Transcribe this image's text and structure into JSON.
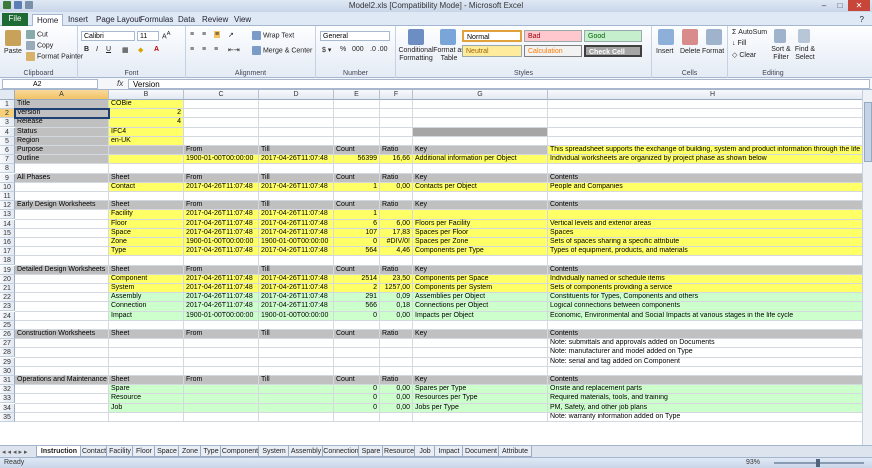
{
  "window": {
    "title": "Model2.xls  [Compatibility Mode]  -  Microsoft Excel"
  },
  "ribbon_tabs": [
    "File",
    "Home",
    "Insert",
    "Page Layout",
    "Formulas",
    "Data",
    "Review",
    "View"
  ],
  "ribbon": {
    "clipboard": {
      "paste": "Paste",
      "cut": "Cut",
      "copy": "Copy",
      "format_painter": "Format Painter",
      "label": "Clipboard"
    },
    "font": {
      "name": "Calibri",
      "size": "11",
      "label": "Font"
    },
    "alignment": {
      "wrap": "Wrap Text",
      "merge": "Merge & Center",
      "label": "Alignment"
    },
    "number": {
      "format": "General",
      "label": "Number"
    },
    "styles": {
      "conditional": "Conditional Formatting",
      "format_table": "Format as Table",
      "normal": "Normal",
      "bad": "Bad",
      "good": "Good",
      "neutral": "Neutral",
      "calculation": "Calculation",
      "check_cell": "Check Cell",
      "label": "Styles"
    },
    "cells": {
      "insert": "Insert",
      "delete": "Delete",
      "format": "Format",
      "label": "Cells"
    },
    "editing": {
      "autosum": "AutoSum",
      "fill": "Fill",
      "clear": "Clear",
      "sort": "Sort & Filter",
      "find": "Find & Select",
      "label": "Editing"
    }
  },
  "formula_bar": {
    "name_box": "A2",
    "fx": "fx",
    "content": "Version"
  },
  "columns": [
    "A",
    "B",
    "C",
    "D",
    "E",
    "F",
    "G",
    "H"
  ],
  "rows": [
    {
      "n": "1",
      "c": [
        {
          "v": "Title",
          "f": "g"
        },
        {
          "v": "COBie",
          "f": "y"
        },
        {},
        {},
        {},
        {},
        {},
        {}
      ]
    },
    {
      "n": "2",
      "c": [
        {
          "v": "Version",
          "f": "g",
          "s": 1
        },
        {
          "v": "2",
          "f": "y",
          "num": 1
        },
        {},
        {},
        {},
        {},
        {},
        {}
      ]
    },
    {
      "n": "3",
      "c": [
        {
          "v": "Release",
          "f": "g"
        },
        {
          "v": "4",
          "f": "y",
          "num": 1
        },
        {},
        {},
        {},
        {},
        {},
        {}
      ]
    },
    {
      "n": "4",
      "c": [
        {
          "v": "Status",
          "f": "g"
        },
        {
          "v": "IFC4",
          "f": "y"
        },
        {},
        {},
        {},
        {},
        {
          "v": "",
          "f": "dg"
        },
        {}
      ]
    },
    {
      "n": "5",
      "c": [
        {
          "v": "Region",
          "f": "g"
        },
        {
          "v": "en-UK",
          "f": "y"
        },
        {},
        {},
        {},
        {},
        {},
        {}
      ]
    },
    {
      "n": "6",
      "c": [
        {
          "v": "Purpose",
          "f": "g"
        },
        {
          "v": "",
          "f": "g"
        },
        {
          "v": "From",
          "f": "g"
        },
        {
          "v": "Till",
          "f": "g"
        },
        {
          "v": "Count",
          "f": "g"
        },
        {
          "v": "Ratio",
          "f": "g"
        },
        {
          "v": "Key",
          "f": "g"
        },
        {
          "v": "This spreadsheet supports the exchange of building, system and product information through the life c",
          "f": "y"
        }
      ]
    },
    {
      "n": "7",
      "c": [
        {
          "v": "Outline",
          "f": "g"
        },
        {
          "v": "",
          "f": "y"
        },
        {
          "v": "1900-01-00T00:00:00",
          "f": "y"
        },
        {
          "v": "2017-04-26T11:07:48",
          "f": "y"
        },
        {
          "v": "56399",
          "f": "y",
          "num": 1
        },
        {
          "v": "16,66",
          "f": "y",
          "num": 1
        },
        {
          "v": "Additional information per Object",
          "f": "y"
        },
        {
          "v": "Individual worksheets are organized by project phase as shown below",
          "f": "y"
        }
      ]
    },
    {
      "n": "8",
      "c": [
        {},
        {},
        {},
        {},
        {},
        {},
        {},
        {}
      ]
    },
    {
      "n": "9",
      "c": [
        {
          "v": "All Phases",
          "f": "g"
        },
        {
          "v": "Sheet",
          "f": "g"
        },
        {
          "v": "From",
          "f": "g"
        },
        {
          "v": "Till",
          "f": "g"
        },
        {
          "v": "Count",
          "f": "g"
        },
        {
          "v": "Ratio",
          "f": "g"
        },
        {
          "v": "Key",
          "f": "g"
        },
        {
          "v": "Contents",
          "f": "g"
        }
      ]
    },
    {
      "n": "10",
      "c": [
        {},
        {
          "v": "Contact",
          "f": "y"
        },
        {
          "v": "2017-04-26T11:07:48",
          "f": "y"
        },
        {
          "v": "2017-04-26T11:07:48",
          "f": "y"
        },
        {
          "v": "1",
          "f": "y",
          "num": 1
        },
        {
          "v": "0,00",
          "f": "y",
          "num": 1
        },
        {
          "v": "Contacts per Object",
          "f": "y"
        },
        {
          "v": "People and Companies",
          "f": "y"
        }
      ]
    },
    {
      "n": "11",
      "c": [
        {},
        {},
        {},
        {},
        {},
        {},
        {},
        {}
      ]
    },
    {
      "n": "12",
      "c": [
        {
          "v": "Early Design Worksheets",
          "f": "g"
        },
        {
          "v": "Sheet",
          "f": "g"
        },
        {
          "v": "From",
          "f": "g"
        },
        {
          "v": "Till",
          "f": "g"
        },
        {
          "v": "Count",
          "f": "g"
        },
        {
          "v": "Ratio",
          "f": "g"
        },
        {
          "v": "Key",
          "f": "g"
        },
        {
          "v": "Contents",
          "f": "g"
        }
      ]
    },
    {
      "n": "13",
      "c": [
        {},
        {
          "v": "Facility",
          "f": "y"
        },
        {
          "v": "2017-04-26T11:07:48",
          "f": "y"
        },
        {
          "v": "2017-04-26T11:07:48",
          "f": "y"
        },
        {
          "v": "1",
          "f": "y",
          "num": 1
        },
        {
          "v": "",
          "f": "y"
        },
        {
          "v": "",
          "f": "y"
        },
        {
          "v": "",
          "f": "y"
        }
      ]
    },
    {
      "n": "14",
      "c": [
        {},
        {
          "v": "Floor",
          "f": "y"
        },
        {
          "v": "2017-04-26T11:07:48",
          "f": "y"
        },
        {
          "v": "2017-04-26T11:07:48",
          "f": "y"
        },
        {
          "v": "6",
          "f": "y",
          "num": 1
        },
        {
          "v": "6,00",
          "f": "y",
          "num": 1
        },
        {
          "v": "Floors per Facility",
          "f": "y"
        },
        {
          "v": "Vertical levels and exterior areas",
          "f": "y"
        }
      ]
    },
    {
      "n": "15",
      "c": [
        {},
        {
          "v": "Space",
          "f": "y"
        },
        {
          "v": "2017-04-26T11:07:48",
          "f": "y"
        },
        {
          "v": "2017-04-26T11:07:48",
          "f": "y"
        },
        {
          "v": "107",
          "f": "y",
          "num": 1
        },
        {
          "v": "17,83",
          "f": "y",
          "num": 1
        },
        {
          "v": "Spaces per Floor",
          "f": "y"
        },
        {
          "v": "Spaces",
          "f": "y"
        }
      ]
    },
    {
      "n": "16",
      "c": [
        {},
        {
          "v": "Zone",
          "f": "y"
        },
        {
          "v": "1900-01-00T00:00:00",
          "f": "y"
        },
        {
          "v": "1900-01-00T00:00:00",
          "f": "y"
        },
        {
          "v": "0",
          "f": "y",
          "num": 1
        },
        {
          "v": "#DIV/0!",
          "f": "y",
          "num": 1
        },
        {
          "v": "Spaces per Zone",
          "f": "y"
        },
        {
          "v": "Sets of spaces sharing a specific attribute",
          "f": "y"
        }
      ]
    },
    {
      "n": "17",
      "c": [
        {},
        {
          "v": "Type",
          "f": "y"
        },
        {
          "v": "2017-04-26T11:07:48",
          "f": "y"
        },
        {
          "v": "2017-04-26T11:07:48",
          "f": "y"
        },
        {
          "v": "564",
          "f": "y",
          "num": 1
        },
        {
          "v": "4,46",
          "f": "y",
          "num": 1
        },
        {
          "v": "Components per Type",
          "f": "y"
        },
        {
          "v": "Types of equipment, products, and materials",
          "f": "y"
        }
      ]
    },
    {
      "n": "18",
      "c": [
        {},
        {},
        {},
        {},
        {},
        {},
        {},
        {}
      ]
    },
    {
      "n": "19",
      "c": [
        {
          "v": "Detailed Design Worksheets",
          "f": "g"
        },
        {
          "v": "Sheet",
          "f": "g"
        },
        {
          "v": "From",
          "f": "g"
        },
        {
          "v": "Till",
          "f": "g"
        },
        {
          "v": "Count",
          "f": "g"
        },
        {
          "v": "Ratio",
          "f": "g"
        },
        {
          "v": "Key",
          "f": "g"
        },
        {
          "v": "Contents",
          "f": "g"
        }
      ]
    },
    {
      "n": "20",
      "c": [
        {},
        {
          "v": "Component",
          "f": "y"
        },
        {
          "v": "2017-04-26T11:07:48",
          "f": "y"
        },
        {
          "v": "2017-04-26T11:07:48",
          "f": "y"
        },
        {
          "v": "2514",
          "f": "y",
          "num": 1
        },
        {
          "v": "23,50",
          "f": "y",
          "num": 1
        },
        {
          "v": "Components per Space",
          "f": "y"
        },
        {
          "v": "Individually named or schedule items",
          "f": "y"
        }
      ]
    },
    {
      "n": "21",
      "c": [
        {},
        {
          "v": "System",
          "f": "y"
        },
        {
          "v": "2017-04-26T11:07:48",
          "f": "y"
        },
        {
          "v": "2017-04-26T11:07:48",
          "f": "y"
        },
        {
          "v": "2",
          "f": "y",
          "num": 1
        },
        {
          "v": "1257,00",
          "f": "y",
          "num": 1
        },
        {
          "v": "Components per System",
          "f": "y"
        },
        {
          "v": "Sets of components providing a service",
          "f": "y"
        }
      ]
    },
    {
      "n": "22",
      "c": [
        {},
        {
          "v": "Assembly",
          "f": "gn"
        },
        {
          "v": "2017-04-26T11:07:48",
          "f": "gn"
        },
        {
          "v": "2017-04-26T11:07:48",
          "f": "gn"
        },
        {
          "v": "291",
          "f": "gn",
          "num": 1
        },
        {
          "v": "0,09",
          "f": "gn",
          "num": 1
        },
        {
          "v": "Assemblies per Object",
          "f": "gn"
        },
        {
          "v": "Constituents for Types, Components and others",
          "f": "gn"
        }
      ]
    },
    {
      "n": "23",
      "c": [
        {},
        {
          "v": "Connection",
          "f": "gn"
        },
        {
          "v": "2017-04-26T11:07:48",
          "f": "gn"
        },
        {
          "v": "2017-04-26T11:07:48",
          "f": "gn"
        },
        {
          "v": "566",
          "f": "gn",
          "num": 1
        },
        {
          "v": "0,18",
          "f": "gn",
          "num": 1
        },
        {
          "v": "Connections per Object",
          "f": "gn"
        },
        {
          "v": "Logical connections between components",
          "f": "gn"
        }
      ]
    },
    {
      "n": "24",
      "c": [
        {},
        {
          "v": "Impact",
          "f": "gn"
        },
        {
          "v": "1900-01-00T00:00:00",
          "f": "gn"
        },
        {
          "v": "1900-01-00T00:00:00",
          "f": "gn"
        },
        {
          "v": "0",
          "f": "gn",
          "num": 1
        },
        {
          "v": "0,00",
          "f": "gn",
          "num": 1
        },
        {
          "v": "Impacts per Object",
          "f": "gn"
        },
        {
          "v": "Economic, Environmental and Social Impacts at various stages in the life cycle",
          "f": "gn"
        }
      ]
    },
    {
      "n": "25",
      "c": [
        {},
        {},
        {},
        {},
        {},
        {},
        {},
        {}
      ]
    },
    {
      "n": "26",
      "c": [
        {
          "v": "Construction Worksheets",
          "f": "g"
        },
        {
          "v": "Sheet",
          "f": "g"
        },
        {
          "v": "From",
          "f": "g"
        },
        {
          "v": "Till",
          "f": "g"
        },
        {
          "v": "Count",
          "f": "g"
        },
        {
          "v": "Ratio",
          "f": "g"
        },
        {
          "v": "Key",
          "f": "g"
        },
        {
          "v": "Contents",
          "f": "g"
        }
      ]
    },
    {
      "n": "27",
      "c": [
        {},
        {},
        {},
        {},
        {},
        {},
        {},
        {
          "v": "Note: submittals and approvals added on Documents"
        }
      ]
    },
    {
      "n": "28",
      "c": [
        {},
        {},
        {},
        {},
        {},
        {},
        {},
        {
          "v": "Note: manufacturer and model added on Type"
        }
      ]
    },
    {
      "n": "29",
      "c": [
        {},
        {},
        {},
        {},
        {},
        {},
        {},
        {
          "v": "Note: serial and tag added on Component"
        }
      ]
    },
    {
      "n": "30",
      "c": [
        {},
        {},
        {},
        {},
        {},
        {},
        {},
        {}
      ]
    },
    {
      "n": "31",
      "c": [
        {
          "v": "Operations and Maintenance",
          "f": "g"
        },
        {
          "v": "Sheet",
          "f": "g"
        },
        {
          "v": "From",
          "f": "g"
        },
        {
          "v": "Till",
          "f": "g"
        },
        {
          "v": "Count",
          "f": "g"
        },
        {
          "v": "Ratio",
          "f": "g"
        },
        {
          "v": "Key",
          "f": "g"
        },
        {
          "v": "Contents",
          "f": "g"
        }
      ]
    },
    {
      "n": "32",
      "c": [
        {},
        {
          "v": "Spare",
          "f": "gn"
        },
        {
          "v": "",
          "f": "gn"
        },
        {
          "v": "",
          "f": "gn"
        },
        {
          "v": "0",
          "f": "gn",
          "num": 1
        },
        {
          "v": "0,00",
          "f": "gn",
          "num": 1
        },
        {
          "v": "Spares per Type",
          "f": "gn"
        },
        {
          "v": "Onsite and replacement parts",
          "f": "gn"
        }
      ]
    },
    {
      "n": "33",
      "c": [
        {},
        {
          "v": "Resource",
          "f": "gn"
        },
        {
          "v": "",
          "f": "gn"
        },
        {
          "v": "",
          "f": "gn"
        },
        {
          "v": "0",
          "f": "gn",
          "num": 1
        },
        {
          "v": "0,00",
          "f": "gn",
          "num": 1
        },
        {
          "v": "Resources per Type",
          "f": "gn"
        },
        {
          "v": "Required materials, tools, and training",
          "f": "gn"
        }
      ]
    },
    {
      "n": "34",
      "c": [
        {},
        {
          "v": "Job",
          "f": "gn"
        },
        {
          "v": "",
          "f": "gn"
        },
        {
          "v": "",
          "f": "gn"
        },
        {
          "v": "0",
          "f": "gn",
          "num": 1
        },
        {
          "v": "0,00",
          "f": "gn",
          "num": 1
        },
        {
          "v": "Jobs per Type",
          "f": "gn"
        },
        {
          "v": "PM, Safety, and other job plans",
          "f": "gn"
        }
      ]
    },
    {
      "n": "35",
      "c": [
        {},
        {},
        {},
        {},
        {},
        {},
        {},
        {
          "v": "Note: warranty information added on Type"
        }
      ]
    }
  ],
  "sheet_tabs": [
    "Instruction",
    "Contact",
    "Facility",
    "Floor",
    "Space",
    "Zone",
    "Type",
    "Component",
    "System",
    "Assembly",
    "Connection",
    "Spare",
    "Resource",
    "Job",
    "Impact",
    "Document",
    "Attribute"
  ],
  "status": {
    "ready": "Ready",
    "zoom": "93%"
  },
  "colors": {
    "yellow": "#ffff66",
    "gray": "#c0c0c0",
    "green": "#ccffcc",
    "file_tab": "#1f6b34"
  }
}
